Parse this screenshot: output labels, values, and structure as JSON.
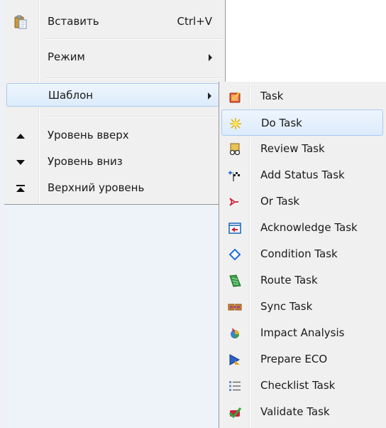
{
  "menu": {
    "items": [
      {
        "label": "Вставить",
        "shortcut": "Ctrl+V",
        "icon": "paste-icon"
      },
      {
        "label": "Режим",
        "icon": "",
        "has_submenu": true
      },
      {
        "label": "Шаблон",
        "icon": "",
        "has_submenu": true,
        "highlighted": true
      },
      {
        "label": "Уровень вверх",
        "icon": "level-up-icon"
      },
      {
        "label": "Уровень вниз",
        "icon": "level-down-icon"
      },
      {
        "label": "Верхний уровень",
        "icon": "top-level-icon"
      }
    ]
  },
  "submenu": {
    "items": [
      {
        "label": "Task",
        "icon": "task-icon"
      },
      {
        "label": "Do Task",
        "icon": "do-task-icon",
        "highlighted": true
      },
      {
        "label": "Review Task",
        "icon": "review-task-icon"
      },
      {
        "label": "Add Status Task",
        "icon": "add-status-task-icon"
      },
      {
        "label": "Or Task",
        "icon": "or-task-icon"
      },
      {
        "label": "Acknowledge Task",
        "icon": "acknowledge-task-icon"
      },
      {
        "label": "Condition Task",
        "icon": "condition-task-icon"
      },
      {
        "label": "Route Task",
        "icon": "route-task-icon"
      },
      {
        "label": "Sync Task",
        "icon": "sync-task-icon"
      },
      {
        "label": "Impact Analysis",
        "icon": "impact-analysis-icon"
      },
      {
        "label": "Prepare ECO",
        "icon": "prepare-eco-icon"
      },
      {
        "label": "Checklist Task",
        "icon": "checklist-task-icon"
      },
      {
        "label": "Validate Task",
        "icon": "validate-task-icon"
      }
    ]
  },
  "colors": {
    "menu_bg": "#f0f0f0",
    "highlight_border": "#a8cbf1",
    "highlight_fill": "#dcebfc"
  }
}
